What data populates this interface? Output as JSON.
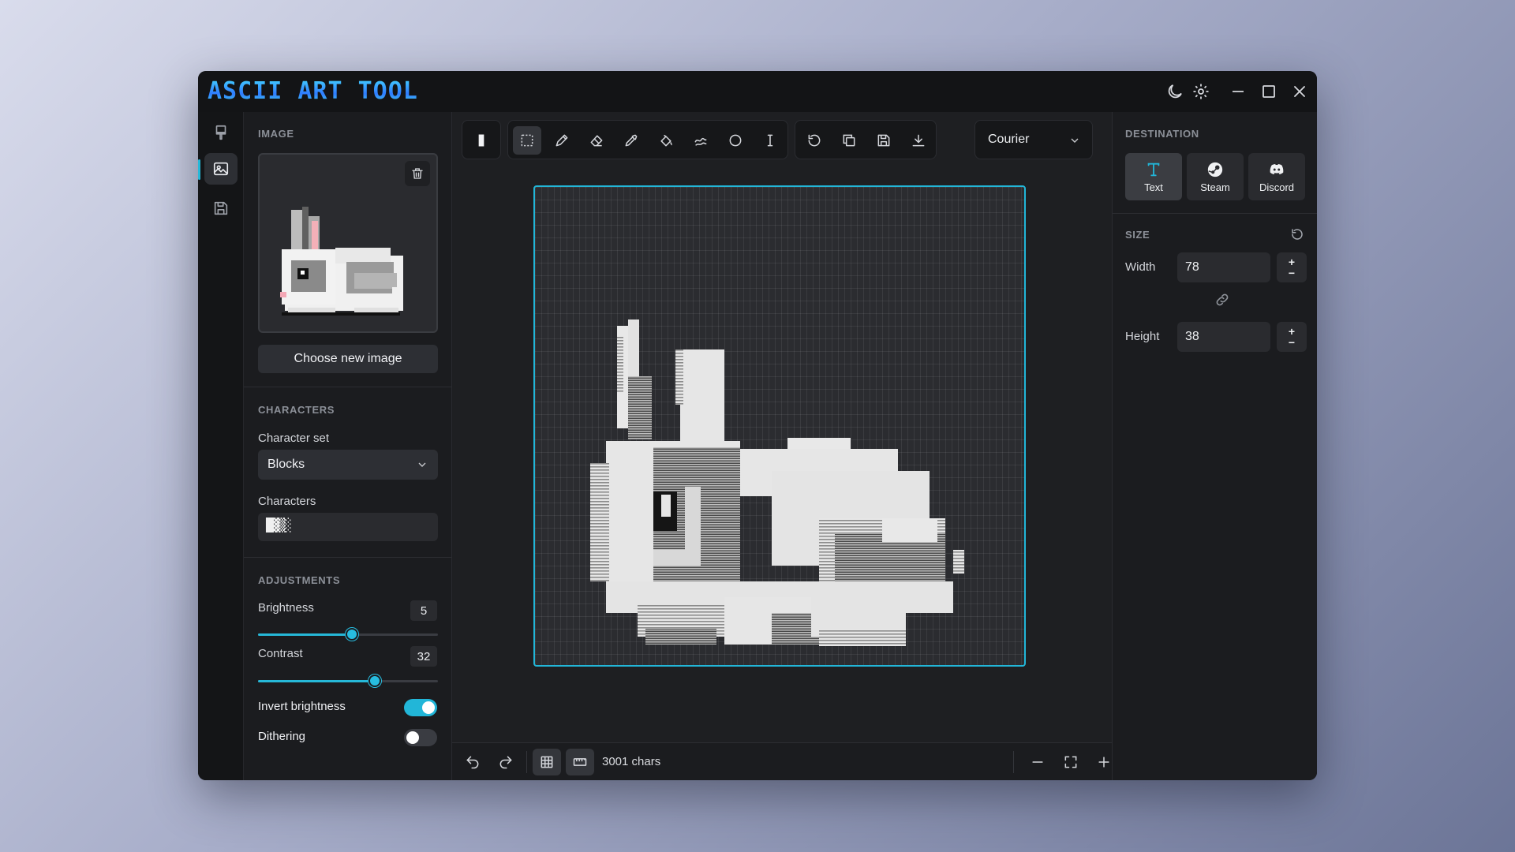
{
  "app": {
    "title": "ASCII ART TOOL"
  },
  "titlebar": {
    "icons": [
      "moon-icon",
      "gear-icon",
      "minimize-icon",
      "maximize-icon",
      "close-icon"
    ]
  },
  "sidebar": {
    "items": [
      "brush-icon",
      "image-icon",
      "save-icon"
    ],
    "active": "image-icon"
  },
  "left_panel": {
    "image": {
      "section_title": "IMAGE",
      "choose_label": "Choose new image"
    },
    "characters": {
      "section_title": "CHARACTERS",
      "set_label": "Character set",
      "set_value": "Blocks",
      "chars_label": "Characters",
      "chars_value": "█▓▒░"
    },
    "adjustments": {
      "section_title": "ADJUSTMENTS",
      "brightness_label": "Brightness",
      "brightness_value": "5",
      "brightness_fraction": 0.52,
      "contrast_label": "Contrast",
      "contrast_value": "32",
      "contrast_fraction": 0.65,
      "invert_label": "Invert brightness",
      "invert_on": true,
      "dither_label": "Dithering",
      "dither_on": false
    }
  },
  "toolbar": {
    "tools": [
      "block-icon",
      "select-icon",
      "pencil-icon",
      "eraser-icon",
      "eyedropper-icon",
      "fill-icon",
      "smudge-icon",
      "circle-icon",
      "text-cursor-icon"
    ],
    "active_tool": "select-icon",
    "actions": [
      "rotate-icon",
      "copy-icon",
      "save-icon",
      "download-icon"
    ],
    "font": "Courier",
    "accent": "#22b6d8"
  },
  "status": {
    "chars_count": "3001 chars"
  },
  "right_panel": {
    "destination_title": "DESTINATION",
    "destinations": [
      {
        "label": "Text",
        "icon": "text-icon",
        "active": true
      },
      {
        "label": "Steam",
        "icon": "steam-icon",
        "active": false
      },
      {
        "label": "Discord",
        "icon": "discord-icon",
        "active": false
      }
    ],
    "size_title": "SIZE",
    "width_label": "Width",
    "width_value": "78",
    "height_label": "Height",
    "height_value": "38",
    "plus": "+",
    "minus": "−"
  }
}
